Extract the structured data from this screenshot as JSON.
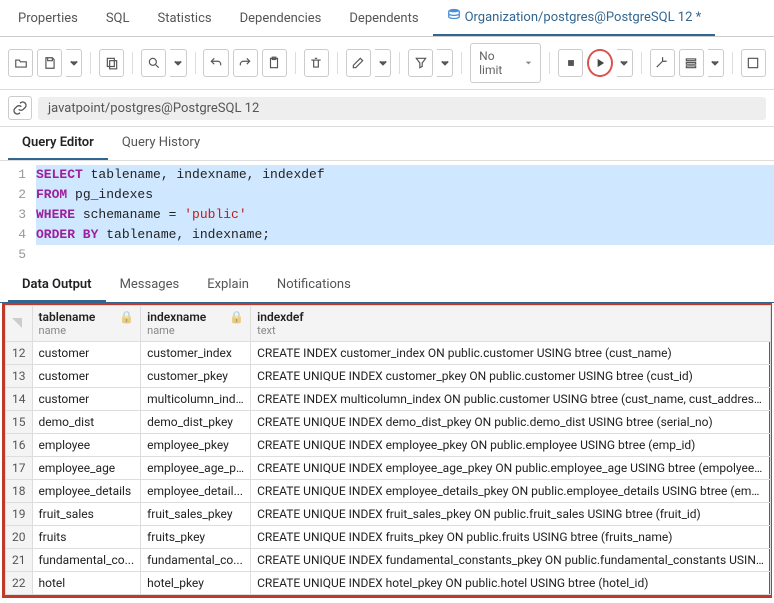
{
  "tabs": {
    "items": [
      "Properties",
      "SQL",
      "Statistics",
      "Dependencies",
      "Dependents"
    ],
    "active": "Organization/postgres@PostgreSQL 12 *"
  },
  "toolbar": {
    "nolimit": "No limit"
  },
  "breadcrumb": {
    "text": "javatpoint/postgres@PostgreSQL 12"
  },
  "subtabs": {
    "active": "Query Editor",
    "other": "Query History"
  },
  "sql": {
    "lines": [
      "1",
      "2",
      "3",
      "4",
      "5"
    ]
  },
  "restabs": {
    "active": "Data Output",
    "others": [
      "Messages",
      "Explain",
      "Notifications"
    ]
  },
  "columns": [
    {
      "name": "tablename",
      "type": "name"
    },
    {
      "name": "indexname",
      "type": "name"
    },
    {
      "name": "indexdef",
      "type": "text"
    }
  ],
  "rows": [
    {
      "n": 12,
      "tablename": "customer",
      "indexname": "customer_index",
      "indexdef": "CREATE INDEX customer_index ON public.customer USING btree (cust_name)"
    },
    {
      "n": 13,
      "tablename": "customer",
      "indexname": "customer_pkey",
      "indexdef": "CREATE UNIQUE INDEX customer_pkey ON public.customer USING btree (cust_id)"
    },
    {
      "n": 14,
      "tablename": "customer",
      "indexname": "multicolumn_ind...",
      "indexdef": "CREATE INDEX multicolumn_index ON public.customer USING btree (cust_name, cust_address, cus"
    },
    {
      "n": 15,
      "tablename": "demo_dist",
      "indexname": "demo_dist_pkey",
      "indexdef": "CREATE UNIQUE INDEX demo_dist_pkey ON public.demo_dist USING btree (serial_no)"
    },
    {
      "n": 16,
      "tablename": "employee",
      "indexname": "employee_pkey",
      "indexdef": "CREATE UNIQUE INDEX employee_pkey ON public.employee USING btree (emp_id)"
    },
    {
      "n": 17,
      "tablename": "employee_age",
      "indexname": "employee_age_p...",
      "indexdef": "CREATE UNIQUE INDEX employee_age_pkey ON public.employee_age USING btree (empolyee_id)"
    },
    {
      "n": 18,
      "tablename": "employee_details",
      "indexname": "employee_detail...",
      "indexdef": "CREATE UNIQUE INDEX employee_details_pkey ON public.employee_details USING btree (emp_id)"
    },
    {
      "n": 19,
      "tablename": "fruit_sales",
      "indexname": "fruit_sales_pkey",
      "indexdef": "CREATE UNIQUE INDEX fruit_sales_pkey ON public.fruit_sales USING btree (fruit_id)"
    },
    {
      "n": 20,
      "tablename": "fruits",
      "indexname": "fruits_pkey",
      "indexdef": "CREATE UNIQUE INDEX fruits_pkey ON public.fruits USING btree (fruits_name)"
    },
    {
      "n": 21,
      "tablename": "fundamental_co...",
      "indexname": "fundamental_co...",
      "indexdef": "CREATE UNIQUE INDEX fundamental_constants_pkey ON public.fundamental_constants USING btr"
    },
    {
      "n": 22,
      "tablename": "hotel",
      "indexname": "hotel_pkey",
      "indexdef": "CREATE UNIQUE INDEX hotel_pkey ON public.hotel USING btree (hotel_id)"
    }
  ]
}
